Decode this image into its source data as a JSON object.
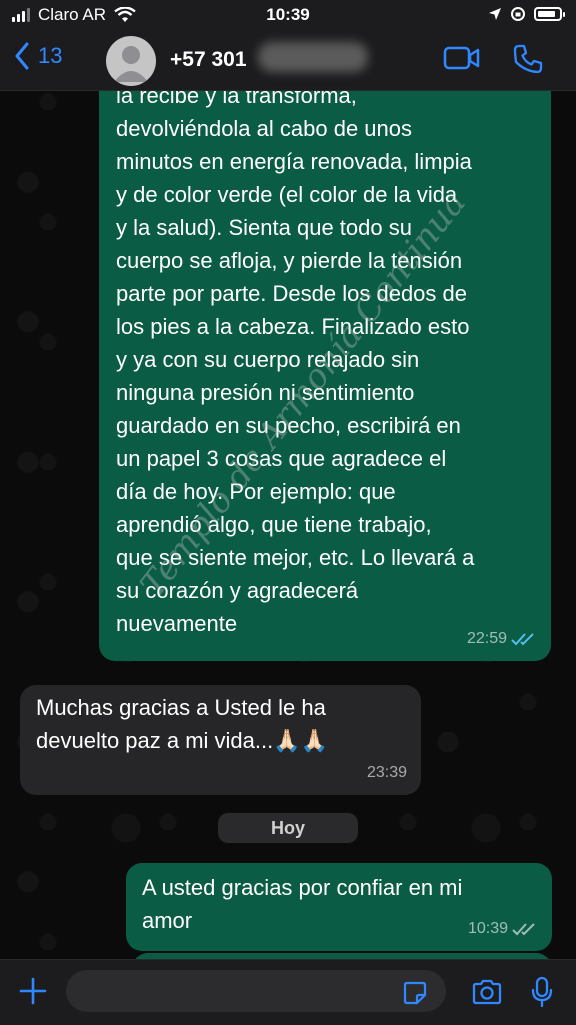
{
  "status_bar": {
    "carrier": "Claro AR",
    "time": "10:39",
    "battery_level": 0.85
  },
  "header": {
    "back_count": "13",
    "contact_name": "+57 301"
  },
  "messages": [
    {
      "direction": "out",
      "text": "la recibe y la transforma,\ndevolviéndola al cabo de unos\nminutos en energía renovada, limpia\ny de color verde (el color de la vida\ny la salud). Sienta que todo su\ncuerpo se afloja, y pierde la tensión\nparte por parte. Desde los dedos de\nlos pies a la cabeza. Finalizado esto\ny ya con su cuerpo relajado sin\nninguna presión ni sentimiento\nguardado en su pecho, escribirá en\nun papel 3 cosas que agradece el\ndía de hoy. Por ejemplo: que\naprendió algo, que tiene trabajo,\nque se siente mejor, etc. Lo llevará a\nsu corazón y agradecerá\nnuevamente",
      "time": "22:59",
      "read": true
    },
    {
      "direction": "in",
      "text": "Muchas gracias a Usted le ha\ndevuelto paz a mi vida...🙏🏻🙏🏻",
      "time": "23:39"
    },
    {
      "direction": "out",
      "text": "A usted gracias por confiar en mi\namor",
      "time": "10:39",
      "read": false
    }
  ],
  "day_divider": "Hoy",
  "watermark": "Templo de Armonía Continua",
  "colors": {
    "outgoing_bubble": "#0b5c44",
    "incoming_bubble": "#262628",
    "accent": "#2f88ff",
    "read_ticks": "#53bdeb"
  },
  "input": {
    "placeholder": ""
  }
}
